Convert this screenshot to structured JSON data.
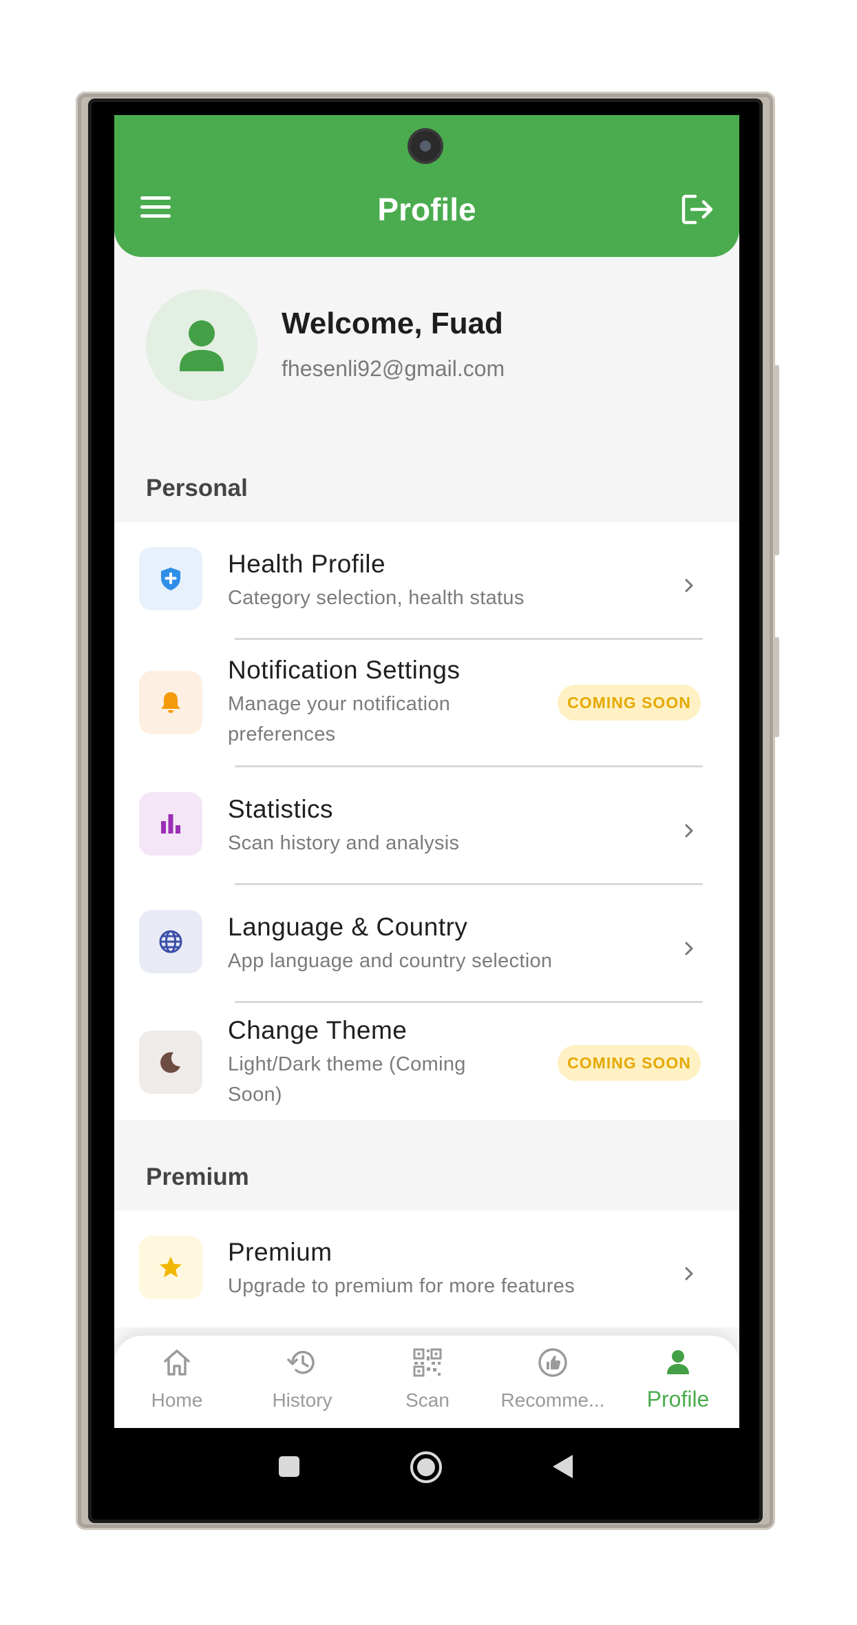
{
  "appbar": {
    "title": "Profile",
    "menu_icon": "hamburger-menu-icon",
    "logout_icon": "logout-icon",
    "color": "#4aac4e"
  },
  "welcome": {
    "title": "Welcome, Fuad",
    "email": "fhesenli92@gmail.com",
    "avatar_icon": "person-icon"
  },
  "sections": {
    "personal": {
      "label": "Personal",
      "items": [
        {
          "title": "Health Profile",
          "subtitle": "Category selection, health status",
          "icon": "shield-plus-icon",
          "icon_color": "#2f8ee8",
          "trailing": "chevron"
        },
        {
          "title": "Notification Settings",
          "subtitle_line1": "Manage your notification",
          "subtitle_line2": "preferences",
          "icon": "bell-icon",
          "icon_color": "#f59a0b",
          "badge": "COMING SOON"
        },
        {
          "title": "Statistics",
          "subtitle": "Scan history and analysis",
          "icon": "bar-chart-icon",
          "icon_color": "#9b2fb5",
          "trailing": "chevron"
        },
        {
          "title": "Language & Country",
          "subtitle": "App language and country selection",
          "icon": "globe-icon",
          "icon_color": "#3b4fa8",
          "trailing": "chevron"
        },
        {
          "title": "Change Theme",
          "subtitle_line1": "Light/Dark theme (Coming",
          "subtitle_line2": "Soon)",
          "icon": "moon-icon",
          "icon_color": "#6d4c41",
          "badge": "COMING SOON"
        }
      ]
    },
    "premium": {
      "label": "Premium",
      "items": [
        {
          "title": "Premium",
          "subtitle": "Upgrade to premium for more features",
          "icon": "star-icon",
          "icon_color": "#f2b705",
          "trailing": "chevron"
        }
      ]
    }
  },
  "bottom_nav": {
    "items": [
      {
        "label": "Home",
        "icon": "home-icon"
      },
      {
        "label": "History",
        "icon": "history-icon"
      },
      {
        "label": "Scan",
        "icon": "qr-scan-icon"
      },
      {
        "label": "Recomme...",
        "icon": "recommendation-icon"
      },
      {
        "label": "Profile",
        "icon": "person-icon",
        "active": true
      }
    ]
  },
  "system_nav": {
    "recents_icon": "square-recents-icon",
    "home_icon": "circle-home-icon",
    "back_icon": "triangle-back-icon"
  }
}
